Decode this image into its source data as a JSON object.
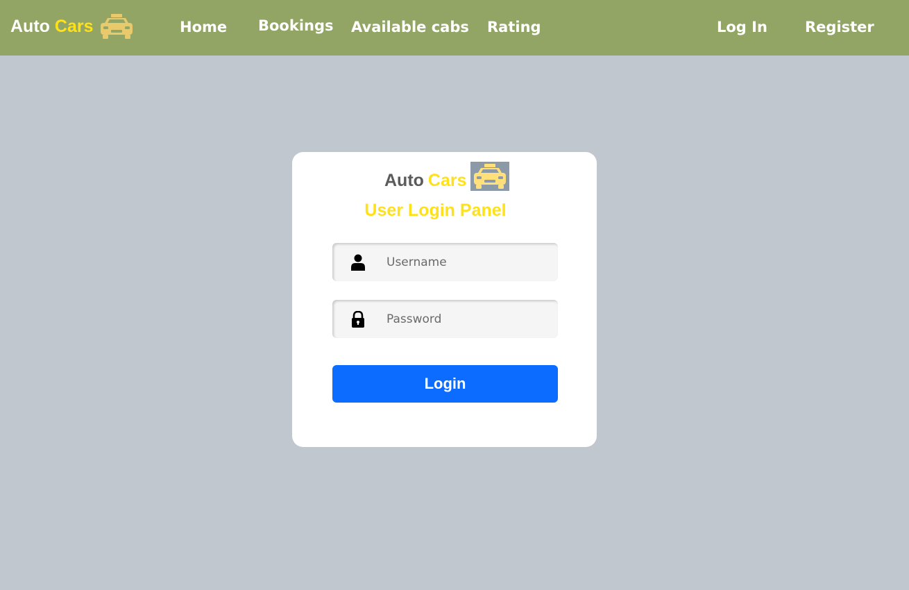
{
  "navbar": {
    "brand_word1": "Auto",
    "brand_word2": "Cars",
    "links": [
      "Home",
      "Bookings",
      "Available cabs",
      "Rating"
    ],
    "login_link": "Log In",
    "register_link": "Register"
  },
  "card": {
    "brand_word1": "Auto",
    "brand_word2": "Cars",
    "title": "User Login Panel",
    "username_placeholder": "Username",
    "password_placeholder": "Password",
    "login_button": "Login"
  },
  "colors": {
    "navbar_bg": "#93a564",
    "page_bg": "#c0c7cf",
    "brand_accent": "#ffe11a",
    "button": "#0b6cff"
  },
  "icons": [
    "taxi-icon",
    "user-icon",
    "lock-icon"
  ]
}
